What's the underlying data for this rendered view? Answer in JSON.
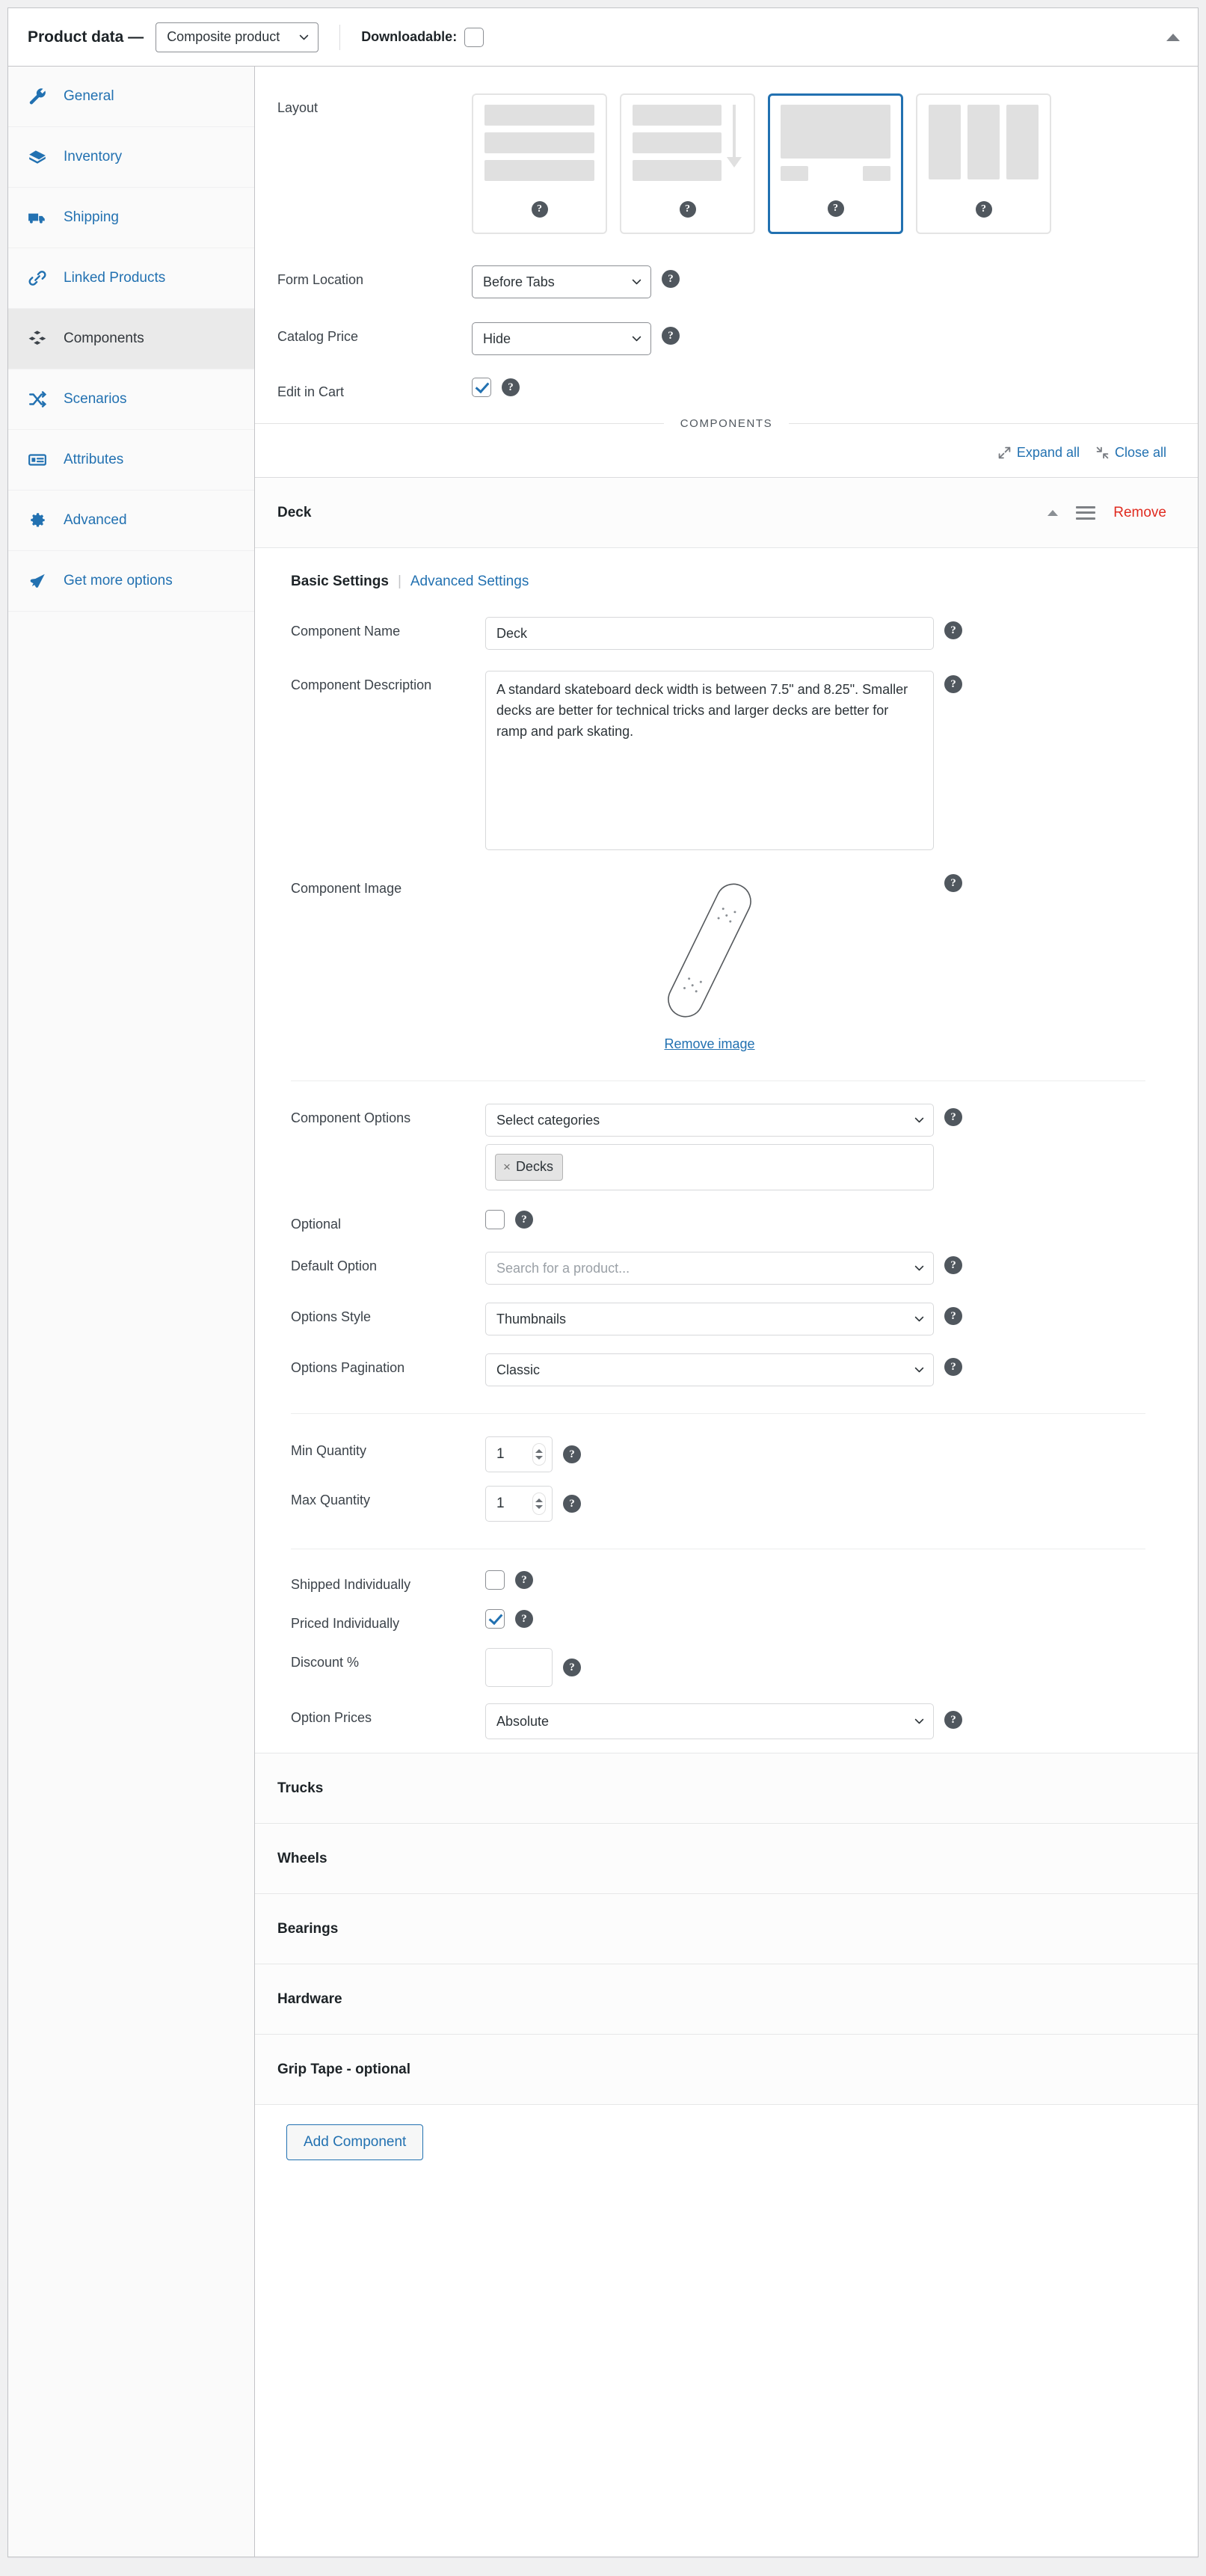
{
  "header": {
    "title": "Product data —",
    "product_type": "Composite product",
    "downloadable_label": "Downloadable:",
    "downloadable_checked": false,
    "collapse_icon": "triangle-up-icon"
  },
  "sidebar": {
    "items": [
      {
        "label": "General",
        "icon": "wrench-icon",
        "active": false
      },
      {
        "label": "Inventory",
        "icon": "archive-icon",
        "active": false
      },
      {
        "label": "Shipping",
        "icon": "truck-icon",
        "active": false
      },
      {
        "label": "Linked Products",
        "icon": "link-icon",
        "active": false
      },
      {
        "label": "Components",
        "icon": "blocks-icon",
        "active": true
      },
      {
        "label": "Scenarios",
        "icon": "shuffle-icon",
        "active": false
      },
      {
        "label": "Attributes",
        "icon": "list-card-icon",
        "active": false
      },
      {
        "label": "Advanced",
        "icon": "gear-icon",
        "active": false
      },
      {
        "label": "Get more options",
        "icon": "megaphone-icon",
        "active": false
      }
    ]
  },
  "settings": {
    "layout_label": "Layout",
    "layout_options": [
      {
        "name": "stacked-layout",
        "selected": false
      },
      {
        "name": "progressive-layout",
        "selected": false
      },
      {
        "name": "single-layout",
        "selected": true
      },
      {
        "name": "columns-layout",
        "selected": false
      }
    ],
    "form_location_label": "Form Location",
    "form_location_value": "Before Tabs",
    "catalog_price_label": "Catalog Price",
    "catalog_price_value": "Hide",
    "edit_in_cart_label": "Edit in Cart",
    "edit_in_cart_checked": true
  },
  "components_section": {
    "band_label": "COMPONENTS",
    "expand_all": "Expand all",
    "close_all": "Close all",
    "add_component": "Add Component"
  },
  "deck": {
    "title": "Deck",
    "remove_label": "Remove",
    "tabs": {
      "basic": "Basic Settings",
      "separator": "|",
      "advanced": "Advanced Settings"
    },
    "fields": {
      "component_name_label": "Component Name",
      "component_name_value": "Deck",
      "component_description_label": "Component Description",
      "component_description_value": "A standard skateboard deck width is between 7.5\" and 8.25\". Smaller decks are better for technical tricks and larger decks are better for ramp and park skating.",
      "component_image_label": "Component Image",
      "remove_image_label": "Remove image",
      "component_options_label": "Component Options",
      "component_options_value": "Select categories",
      "component_options_tag": "Decks",
      "tag_remove_glyph": "×",
      "optional_label": "Optional",
      "optional_checked": false,
      "default_option_label": "Default Option",
      "default_option_placeholder": "Search for a product...",
      "options_style_label": "Options Style",
      "options_style_value": "Thumbnails",
      "options_pagination_label": "Options Pagination",
      "options_pagination_value": "Classic",
      "min_quantity_label": "Min Quantity",
      "min_quantity_value": "1",
      "max_quantity_label": "Max Quantity",
      "max_quantity_value": "1",
      "shipped_individually_label": "Shipped Individually",
      "shipped_individually_checked": false,
      "priced_individually_label": "Priced Individually",
      "priced_individually_checked": true,
      "discount_label": "Discount %",
      "discount_value": "",
      "option_prices_label": "Option Prices",
      "option_prices_value": "Absolute"
    }
  },
  "collapsed_components": [
    {
      "label": "Trucks"
    },
    {
      "label": "Wheels"
    },
    {
      "label": "Bearings"
    },
    {
      "label": "Hardware"
    },
    {
      "label": "Grip Tape - optional"
    }
  ],
  "colors": {
    "accent": "#2271b1",
    "danger": "#e02b20",
    "text": "#1d2327",
    "muted": "#50575e",
    "border": "#c3c4c7"
  }
}
